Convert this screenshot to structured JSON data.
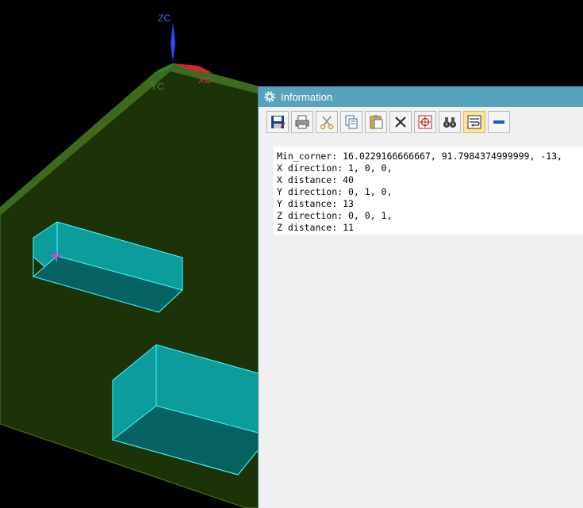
{
  "viewport": {
    "axes": {
      "z": "ZC",
      "y": "YC",
      "x": "XC"
    }
  },
  "window": {
    "title": "Information",
    "toolbar": [
      {
        "name": "save-icon"
      },
      {
        "name": "print-icon"
      },
      {
        "name": "cut-icon"
      },
      {
        "name": "copy-icon"
      },
      {
        "name": "paste-icon"
      },
      {
        "name": "delete-icon"
      },
      {
        "name": "crosshair-icon"
      },
      {
        "name": "binoculars-icon"
      },
      {
        "name": "word-wrap-icon",
        "active": true
      },
      {
        "name": "minimize-icon"
      }
    ],
    "output_lines": [
      "Min_corner: 16.0229166666667, 91.7984374999999, -13,",
      "X direction: 1, 0, 0,",
      "X distance: 40",
      "Y direction: 0, 1, 0,",
      "Y distance: 13",
      "Z direction: 0, 0, 1,",
      "Z distance: 11"
    ]
  },
  "colors": {
    "plate": "#1c3308",
    "plate_edge": "#3e6a1e",
    "block_top": "#0c9c9c",
    "block_side": "#066262",
    "block_edge": "#40ffff",
    "titlebar": "#56a3be"
  }
}
